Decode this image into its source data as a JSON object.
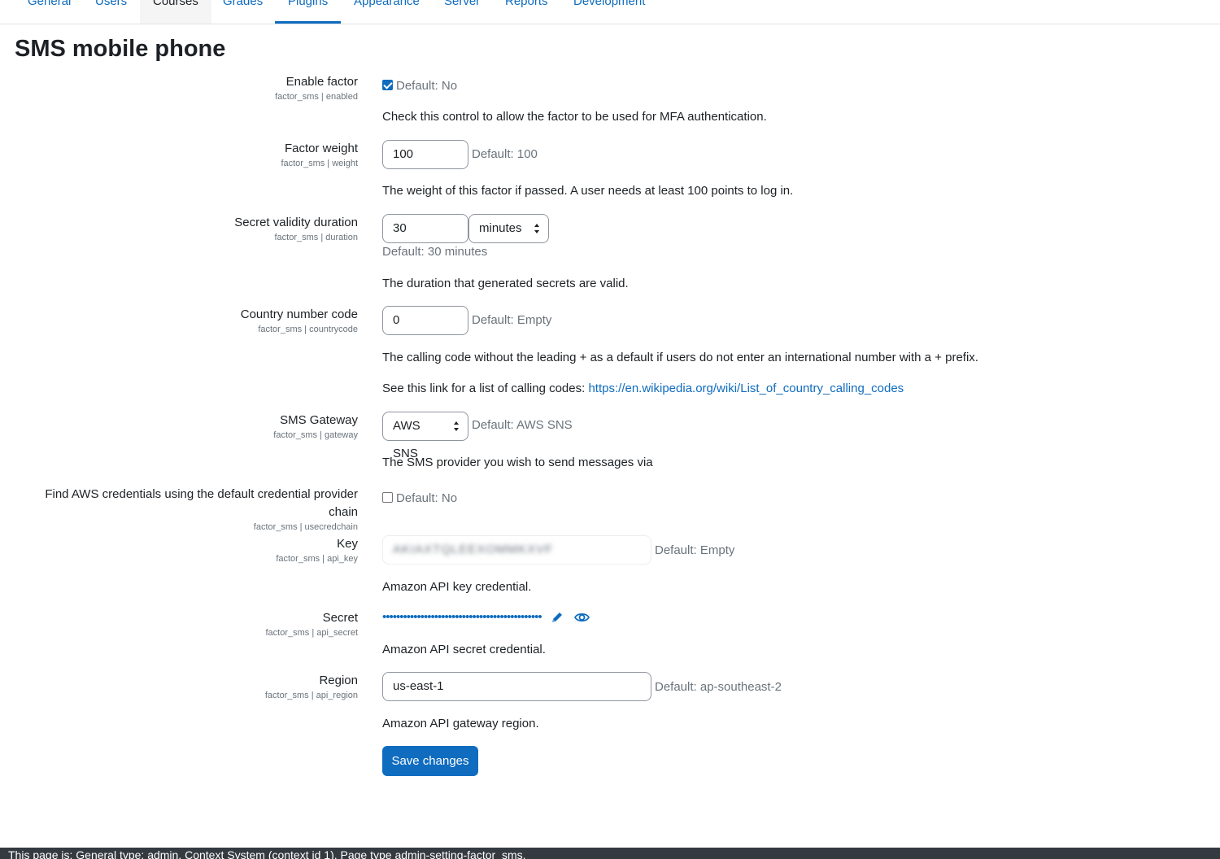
{
  "nav": {
    "tabs": [
      {
        "label": "General"
      },
      {
        "label": "Users"
      },
      {
        "label": "Courses"
      },
      {
        "label": "Grades"
      },
      {
        "label": "Plugins"
      },
      {
        "label": "Appearance"
      },
      {
        "label": "Server"
      },
      {
        "label": "Reports"
      },
      {
        "label": "Development"
      }
    ],
    "active_tab": "Plugins"
  },
  "page": {
    "title": "SMS mobile phone"
  },
  "settings": {
    "enabled": {
      "label": "Enable factor",
      "key": "factor_sms | enabled",
      "checked": true,
      "default": "Default: No",
      "description": "Check this control to allow the factor to be used for MFA authentication."
    },
    "weight": {
      "label": "Factor weight",
      "key": "factor_sms | weight",
      "value": "100",
      "default": "Default: 100",
      "description": "The weight of this factor if passed. A user needs at least 100 points to log in."
    },
    "duration": {
      "label": "Secret validity duration",
      "key": "factor_sms | duration",
      "value": "30",
      "unit": "minutes",
      "default": "Default: 30 minutes",
      "description": "The duration that generated secrets are valid."
    },
    "countrycode": {
      "label": "Country number code",
      "key": "factor_sms | countrycode",
      "value": "0",
      "default": "Default: Empty",
      "description": "The calling code without the leading + as a default if users do not enter an international number with a + prefix.",
      "link_prefix": "See this link for a list of calling codes: ",
      "link": "https://en.wikipedia.org/wiki/List_of_country_calling_codes"
    },
    "gateway": {
      "label": "SMS Gateway",
      "key": "factor_sms | gateway",
      "value": "AWS SNS",
      "default": "Default: AWS SNS",
      "description": "The SMS provider you wish to send messages via"
    },
    "usecredchain": {
      "label_line1": "Find AWS credentials using the default credential provider",
      "label_line2": "chain",
      "key": "factor_sms | usecredchain",
      "checked": false,
      "default": "Default: No"
    },
    "api_key": {
      "label": "Key",
      "key": "factor_sms | api_key",
      "value": "AKIAXTQLEEXOMMKXVF",
      "default": "Default: Empty",
      "description": "Amazon API key credential."
    },
    "api_secret": {
      "label": "Secret",
      "key": "factor_sms | api_secret",
      "masked": "••••••••••••••••••••••••••••••••••••••••••••••",
      "description": "Amazon API secret credential."
    },
    "api_region": {
      "label": "Region",
      "key": "factor_sms | api_region",
      "value": "us-east-1",
      "default": "Default: ap-southeast-2",
      "description": "Amazon API gateway region."
    }
  },
  "actions": {
    "save_label": "Save changes"
  },
  "footer": {
    "text": "This page is: General type: admin. Context System (context id 1). Page type admin-setting-factor_sms."
  },
  "colors": {
    "accent": "#0f6cbf",
    "text": "#1d2125",
    "muted": "#6a737b",
    "footer_bg": "#343a40"
  }
}
